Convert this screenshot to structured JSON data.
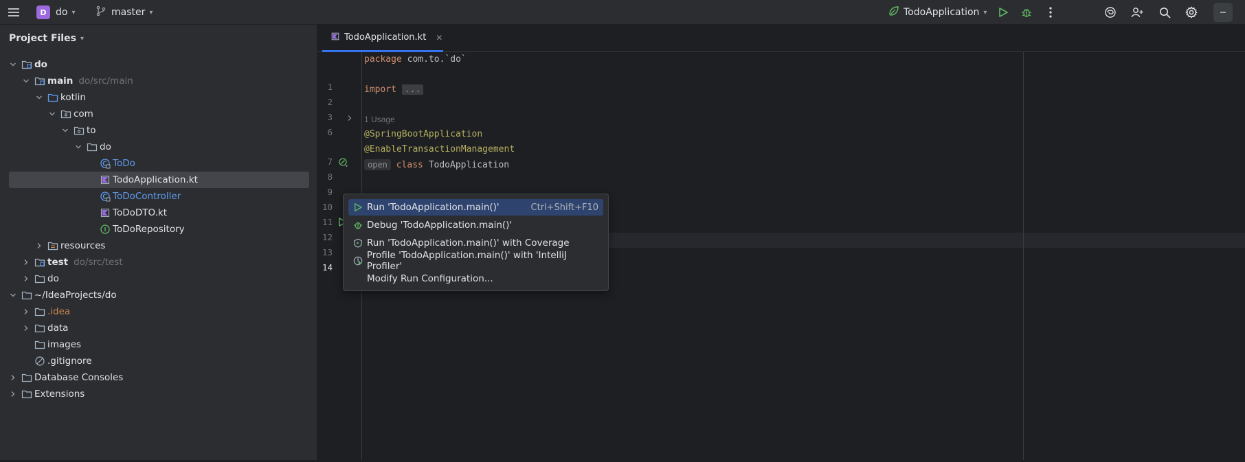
{
  "titlebar": {
    "project_initial": "D",
    "project_name": "do",
    "branch": "master",
    "run_config": "TodoApplication"
  },
  "panel": {
    "title": "Project Files"
  },
  "tree": [
    {
      "label": "do",
      "hint": "",
      "bold": true
    },
    {
      "label": "main",
      "hint": "do/src/main",
      "bold": true
    },
    {
      "label": "kotlin",
      "hint": ""
    },
    {
      "label": "com",
      "hint": ""
    },
    {
      "label": "to",
      "hint": ""
    },
    {
      "label": "do",
      "hint": ""
    },
    {
      "label": "ToDo",
      "hint": ""
    },
    {
      "label": "TodoApplication.kt",
      "hint": ""
    },
    {
      "label": "ToDoController",
      "hint": ""
    },
    {
      "label": "ToDoDTO.kt",
      "hint": ""
    },
    {
      "label": "ToDoRepository",
      "hint": ""
    },
    {
      "label": "resources",
      "hint": ""
    },
    {
      "label": "test",
      "hint": "do/src/test",
      "bold": true
    },
    {
      "label": "do",
      "hint": ""
    },
    {
      "label": "~/IdeaProjects/do",
      "hint": ""
    },
    {
      "label": ".idea",
      "hint": ""
    },
    {
      "label": "data",
      "hint": ""
    },
    {
      "label": "images",
      "hint": ""
    },
    {
      "label": ".gitignore",
      "hint": ""
    },
    {
      "label": "Database Consoles",
      "hint": ""
    },
    {
      "label": "Extensions",
      "hint": ""
    }
  ],
  "editor": {
    "tab_label": "TodoApplication.kt",
    "line_numbers": [
      "1",
      "2",
      "3",
      "6",
      "7",
      "8",
      "9",
      "10",
      "11",
      "12",
      "13",
      "14"
    ],
    "code": {
      "l1_kw": "package",
      "l1_rest": " com.to.`do`",
      "l3_kw": "import",
      "l3_fold": "...",
      "usage": "1 Usage",
      "l7": "@SpringBootApplication",
      "l8": "@EnableTransactionManagement",
      "l9_open": "open",
      "l9_kw": "class",
      "l9_rest": " TodoApplication"
    }
  },
  "menu": {
    "items": [
      {
        "label": "Run 'TodoApplication.main()'",
        "shortcut": "Ctrl+Shift+F10"
      },
      {
        "label": "Debug 'TodoApplication.main()'",
        "shortcut": ""
      },
      {
        "label": "Run 'TodoApplication.main()' with Coverage",
        "shortcut": ""
      },
      {
        "label": "Profile 'TodoApplication.main()' with 'IntelliJ Profiler'",
        "shortcut": ""
      },
      {
        "label": "Modify Run Configuration...",
        "shortcut": ""
      }
    ]
  }
}
